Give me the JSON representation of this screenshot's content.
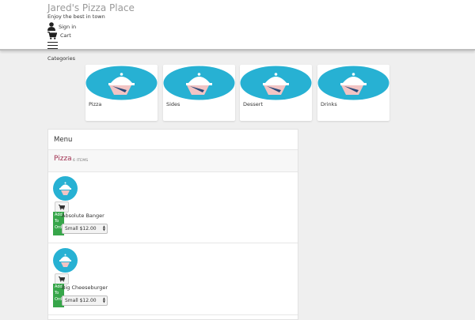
{
  "header": {
    "site_title": "Jared's Pizza Place",
    "tagline": "Enjoy the best in town",
    "signin_label": "Sign in",
    "cart_label": "Cart"
  },
  "categories": {
    "label": "Categories",
    "items": [
      {
        "name": "Pizza"
      },
      {
        "name": "Sides"
      },
      {
        "name": "Dessert"
      },
      {
        "name": "Drinks"
      }
    ]
  },
  "menu": {
    "title": "Menu",
    "section_name": "Pizza",
    "section_count": "6 ITEMS",
    "add_to_order_label": "Add To Order",
    "items": [
      {
        "name": "Absolute Banger",
        "price": "$12.00",
        "price_option": "Small"
      },
      {
        "name": "Big Cheeseburger",
        "price": "$12.00",
        "price_option": "Small"
      }
    ]
  },
  "colors": {
    "accent_section": "#a03050",
    "card_image_bg": "#27b1d3",
    "add_button": "#37a64a"
  },
  "icons": {
    "category_image": "serving-cloche-icon",
    "cart": "shopping-cart-icon",
    "user": "user-icon",
    "menu": "hamburger-icon"
  }
}
